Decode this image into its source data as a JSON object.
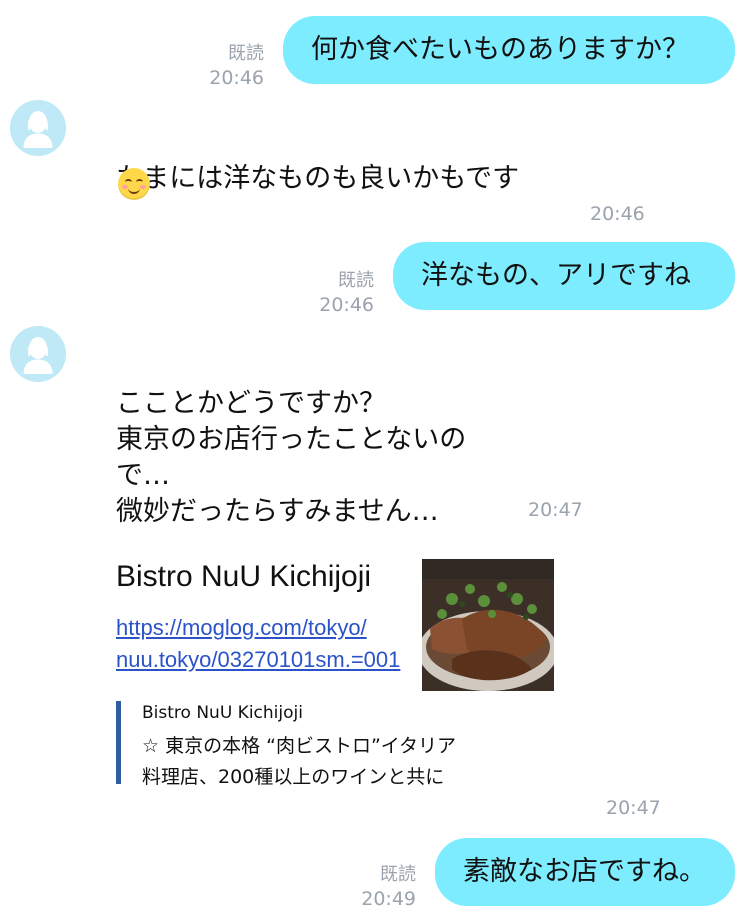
{
  "messages": [
    {
      "side": "out",
      "text": "何か食べたいものありますか？",
      "read": "既読",
      "time": "20:46"
    },
    {
      "side": "in",
      "text": "たまには洋なものも良いかもです",
      "time": "20:46"
    },
    {
      "side": "out",
      "text": "洋なもの、アリですね",
      "read": "既読",
      "time": "20:46"
    },
    {
      "side": "in",
      "text": "こことかどうですか？\n東京のお店行ったことないの\nで…\n微妙だったらすみません…",
      "time": "20:47"
    },
    {
      "side": "in",
      "type": "link",
      "title": "Bistro NuU Kichijoji",
      "url_line1": "https://moglog.com/tokyo/",
      "url_line2": "nuu.tokyo/03270101sm.=001",
      "quote_title": "Bistro NuU Kichijoji",
      "quote_desc": "☆ 東京の本格 “肉ビストロ”イタリア\n  料理店、200種以上のワインと共に",
      "time": "20:47"
    },
    {
      "side": "out",
      "text": "素敵なお店ですね。",
      "read": "既読",
      "time": "20:49"
    }
  ],
  "colors": {
    "bubble_out": "#7eecff",
    "meta": "#9aa3ad",
    "link": "#2a53c9",
    "quote_bar": "#2f5d9e",
    "avatar_bg": "#bfe9f6"
  },
  "icons": {
    "avatar": "person-avatar-icon",
    "emoji": "smiling-face-emoji"
  }
}
